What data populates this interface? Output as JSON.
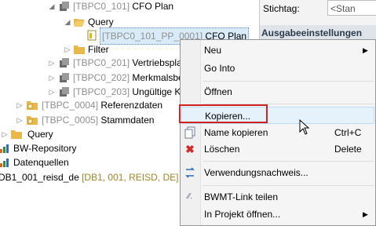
{
  "tree": {
    "rows": [
      {
        "id": "TBPC0_101",
        "pre": "[TBPC0_101]",
        "name": " CFO Plan"
      },
      {
        "name": "Query"
      },
      {
        "id": "[TBPC0_101_PP_0001]",
        "name": " CFO Plan"
      },
      {
        "name": "Filter"
      },
      {
        "id": "[TBPC0_201]",
        "name": " Vertriebspla"
      },
      {
        "id": "[TBPC0_202]",
        "name": " Merkmalsbe"
      },
      {
        "id": "[TBPC0_203]",
        "name": " Ungültige K"
      },
      {
        "id": "[TBPC_0004]",
        "name": " Referenzdaten"
      },
      {
        "id": "[TBPC_0005]",
        "name": " Stammdaten"
      },
      {
        "name": "Query"
      },
      {
        "name": "BW-Repository"
      },
      {
        "name": "Datenquellen"
      },
      {
        "name": "DB1_001_reisd_de",
        "extra": " [DB1, 001, REISD, DE]"
      }
    ]
  },
  "panel": {
    "stichtag_label": "Stichtag:",
    "stichtag_value": "<Stan",
    "section_title": "Ausgabeeinstellungen"
  },
  "menu": {
    "items": [
      {
        "label": "Neu"
      },
      {
        "label": "Go Into"
      },
      {
        "label": "Öffnen"
      },
      {
        "label": "Kopieren..."
      },
      {
        "label": "Name kopieren",
        "shortcut": "Ctrl+C"
      },
      {
        "label": "Löschen",
        "shortcut": "Delete"
      },
      {
        "label": "Verwendungsnachweis..."
      },
      {
        "label": "BWMT-Link teilen"
      },
      {
        "label": "In Projekt öffnen..."
      }
    ]
  },
  "colors": {
    "highlight": "#d0231f",
    "selection": "#d9ebf9",
    "folder": "#e8b84a"
  }
}
